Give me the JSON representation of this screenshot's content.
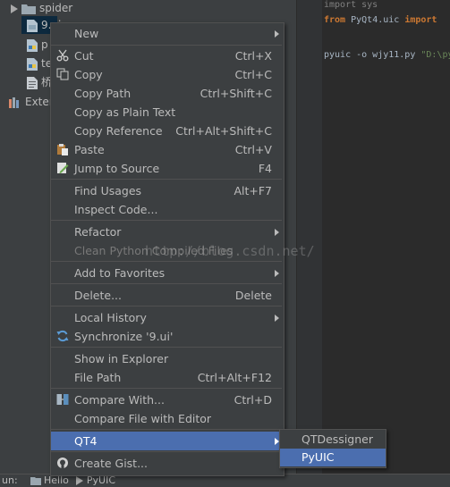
{
  "project_tree": {
    "items": [
      {
        "label": "spider"
      },
      {
        "label": "9.ui"
      },
      {
        "label": "p"
      },
      {
        "label": "te"
      },
      {
        "label": "桥"
      },
      {
        "label": "Exter"
      }
    ]
  },
  "editor": {
    "lines": [
      {
        "kw": "import",
        "rest": " sys"
      },
      {
        "kw": "from",
        "rest": " PyQt4.uic ",
        "kw2": "import"
      },
      {
        "cmd": "pyuic -o wjy11.py ",
        "str": "\"D:\\py"
      }
    ]
  },
  "context_menu": {
    "items": [
      {
        "label": "New",
        "submenu": true
      },
      {
        "label": "Cut",
        "shortcut": "Ctrl+X",
        "icon": "scissors-icon"
      },
      {
        "label": "Copy",
        "shortcut": "Ctrl+C",
        "icon": "copy-icon"
      },
      {
        "label": "Copy Path",
        "shortcut": "Ctrl+Shift+C"
      },
      {
        "label": "Copy as Plain Text"
      },
      {
        "label": "Copy Reference",
        "shortcut": "Ctrl+Alt+Shift+C"
      },
      {
        "label": "Paste",
        "shortcut": "Ctrl+V",
        "icon": "paste-icon"
      },
      {
        "label": "Jump to Source",
        "shortcut": "F4",
        "icon": "edit-source-icon"
      },
      {
        "label": "Find Usages",
        "shortcut": "Alt+F7"
      },
      {
        "label": "Inspect Code..."
      },
      {
        "label": "Refactor",
        "submenu": true
      },
      {
        "label": "Clean Python Compiled Files",
        "disabled": true
      },
      {
        "label": "Add to Favorites",
        "submenu": true
      },
      {
        "label": "Delete...",
        "shortcut": "Delete"
      },
      {
        "label": "Local History",
        "submenu": true
      },
      {
        "label": "Synchronize '9.ui'",
        "icon": "sync-icon"
      },
      {
        "label": "Show in Explorer"
      },
      {
        "label": "File Path",
        "shortcut": "Ctrl+Alt+F12"
      },
      {
        "label": "Compare With...",
        "shortcut": "Ctrl+D",
        "icon": "compare-icon"
      },
      {
        "label": "Compare File with Editor"
      },
      {
        "label": "QT4",
        "submenu": true,
        "highlighted": true
      },
      {
        "label": "Create Gist...",
        "icon": "github-icon"
      }
    ]
  },
  "qt4_submenu": {
    "items": [
      {
        "label": "QTDessigner"
      },
      {
        "label": "PyUIC",
        "highlighted": true
      }
    ]
  },
  "watermark": "http://blog.csdn.net/",
  "statusbar": {
    "run_label": "un:",
    "tab1": "Hello",
    "tab2": "PyUIC"
  },
  "colors": {
    "menu_bg": "#3c3f41",
    "highlight": "#4b6eaf",
    "editor_bg": "#2b2b2b",
    "keyword": "#cc7832",
    "string": "#6a8759"
  }
}
